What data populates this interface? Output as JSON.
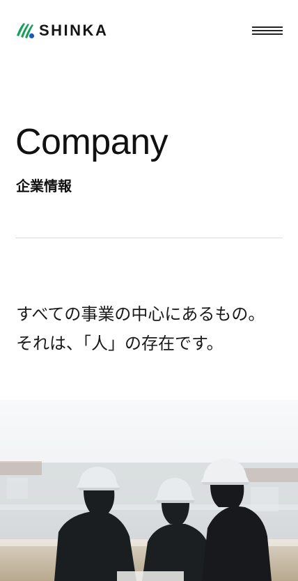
{
  "header": {
    "brand": "SHINKA",
    "logo_icon": "shinka-brushstroke-logo-icon",
    "menu_icon": "hamburger-menu-icon",
    "colors": {
      "logo_green": "#18a05a",
      "logo_blue": "#1e5bb8"
    }
  },
  "page": {
    "title_en": "Company",
    "title_ja": "企業情報"
  },
  "lead": {
    "line1": "すべての事業の中心にあるもの。",
    "line2": "それは、「人」の存在です。"
  },
  "hero": {
    "image": "hero-photo-workers-in-hard-hats"
  }
}
